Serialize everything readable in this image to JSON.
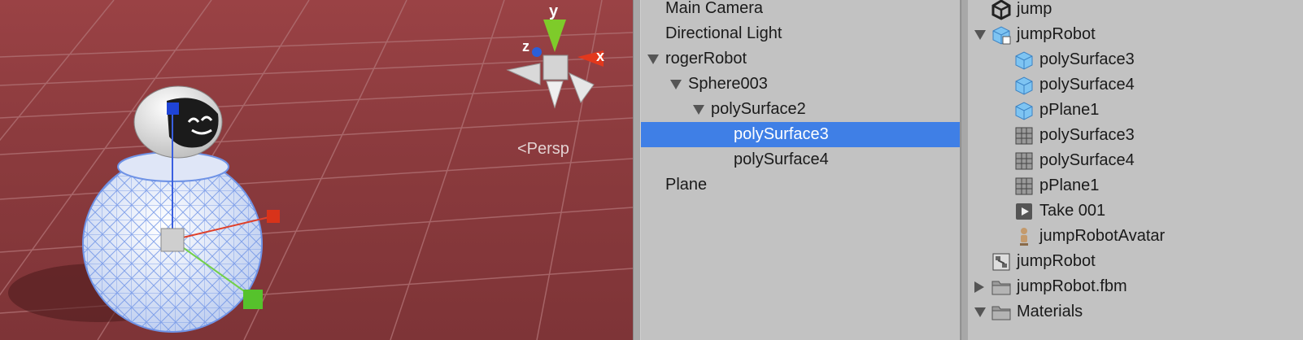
{
  "scene": {
    "projection_label": "<Persp",
    "gizmo": {
      "x_label": "x",
      "y_label": "y",
      "z_label": "z"
    }
  },
  "hierarchy": {
    "items": [
      {
        "label": "Main Camera",
        "depth": 0,
        "expanded": null,
        "selected": false
      },
      {
        "label": "Directional Light",
        "depth": 0,
        "expanded": null,
        "selected": false
      },
      {
        "label": "rogerRobot",
        "depth": 0,
        "expanded": true,
        "selected": false
      },
      {
        "label": "Sphere003",
        "depth": 1,
        "expanded": true,
        "selected": false
      },
      {
        "label": "polySurface2",
        "depth": 2,
        "expanded": true,
        "selected": false
      },
      {
        "label": "polySurface3",
        "depth": 3,
        "expanded": null,
        "selected": true
      },
      {
        "label": "polySurface4",
        "depth": 3,
        "expanded": null,
        "selected": false
      },
      {
        "label": "Plane",
        "depth": 0,
        "expanded": null,
        "selected": false
      }
    ]
  },
  "project": {
    "items": [
      {
        "label": "jump",
        "depth": 1,
        "icon": "unity-logo-icon",
        "expanded": null
      },
      {
        "label": "jumpRobot",
        "depth": 1,
        "icon": "model-prefab-icon",
        "expanded": true
      },
      {
        "label": "polySurface3",
        "depth": 2,
        "icon": "mesh-object-icon",
        "expanded": null
      },
      {
        "label": "polySurface4",
        "depth": 2,
        "icon": "mesh-object-icon",
        "expanded": null
      },
      {
        "label": "pPlane1",
        "depth": 2,
        "icon": "mesh-object-icon",
        "expanded": null
      },
      {
        "label": "polySurface3",
        "depth": 2,
        "icon": "mesh-grid-icon",
        "expanded": null
      },
      {
        "label": "polySurface4",
        "depth": 2,
        "icon": "mesh-grid-icon",
        "expanded": null
      },
      {
        "label": "pPlane1",
        "depth": 2,
        "icon": "mesh-grid-icon",
        "expanded": null
      },
      {
        "label": "Take 001",
        "depth": 2,
        "icon": "animation-clip-icon",
        "expanded": null
      },
      {
        "label": "jumpRobotAvatar",
        "depth": 2,
        "icon": "avatar-icon",
        "expanded": null
      },
      {
        "label": "jumpRobot",
        "depth": 1,
        "icon": "animator-controller-icon",
        "expanded": null
      },
      {
        "label": "jumpRobot.fbm",
        "depth": 1,
        "icon": "folder-icon",
        "expanded": false
      },
      {
        "label": "Materials",
        "depth": 1,
        "icon": "folder-icon",
        "expanded": true
      }
    ]
  }
}
